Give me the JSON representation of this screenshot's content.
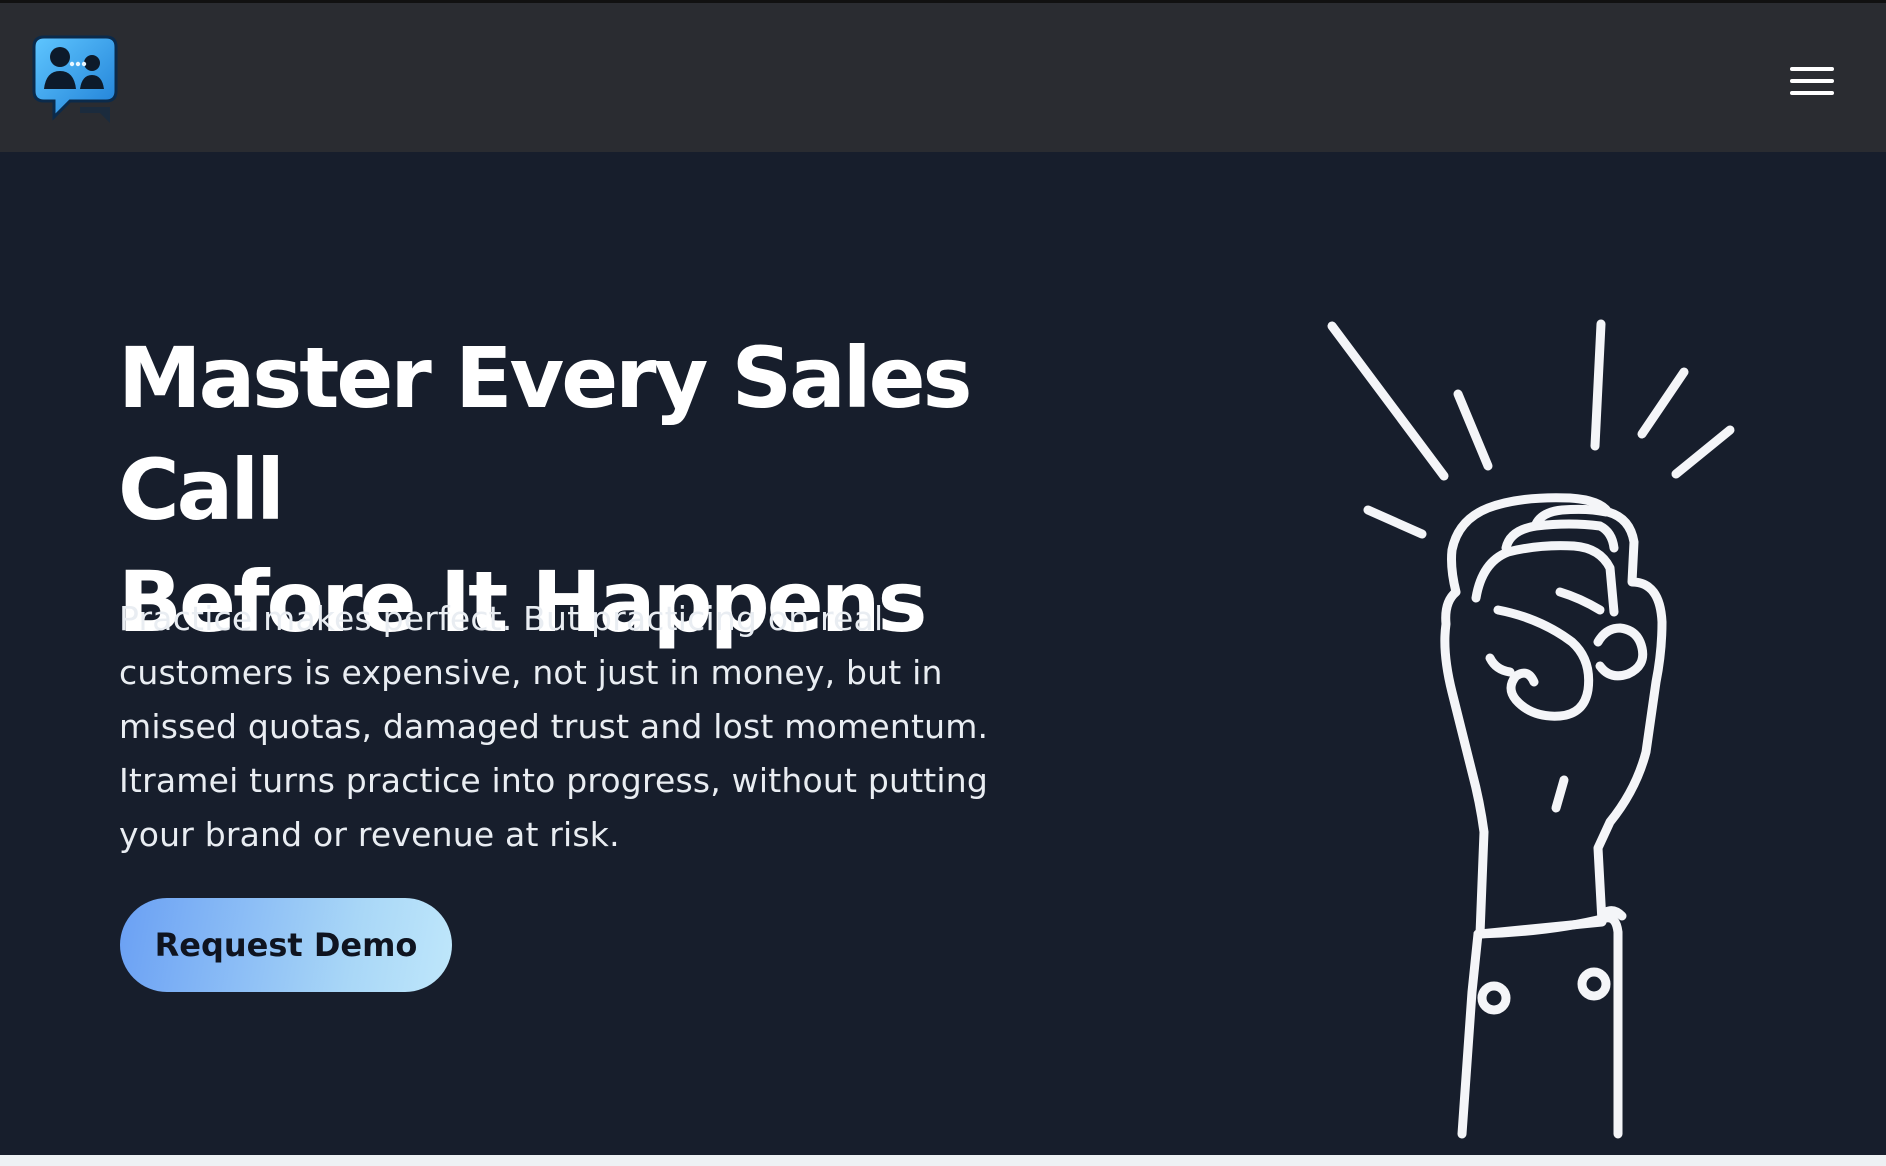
{
  "navbar": {
    "logo_icon": "chat-people-logo-icon",
    "menu_icon": "hamburger-menu-icon"
  },
  "hero": {
    "title_line1": "Master Every Sales Call",
    "title_line2": "Before It Happens",
    "description": "Practice makes perfect. But practicing on real customers is expensive, not just in money, but in missed quotas, damaged trust and lost momentum. Itramei turns practice into progress, without putting your brand or revenue at risk.",
    "cta_label": "Request Demo",
    "illustration_icon": "raised-fist-icon"
  },
  "colors": {
    "navbar_bg": "#2a2c31",
    "hero_bg": "#171e2c",
    "cta_gradient_start": "#6aa0f4",
    "cta_gradient_end": "#bfe7fb",
    "text_primary": "#ffffff"
  }
}
